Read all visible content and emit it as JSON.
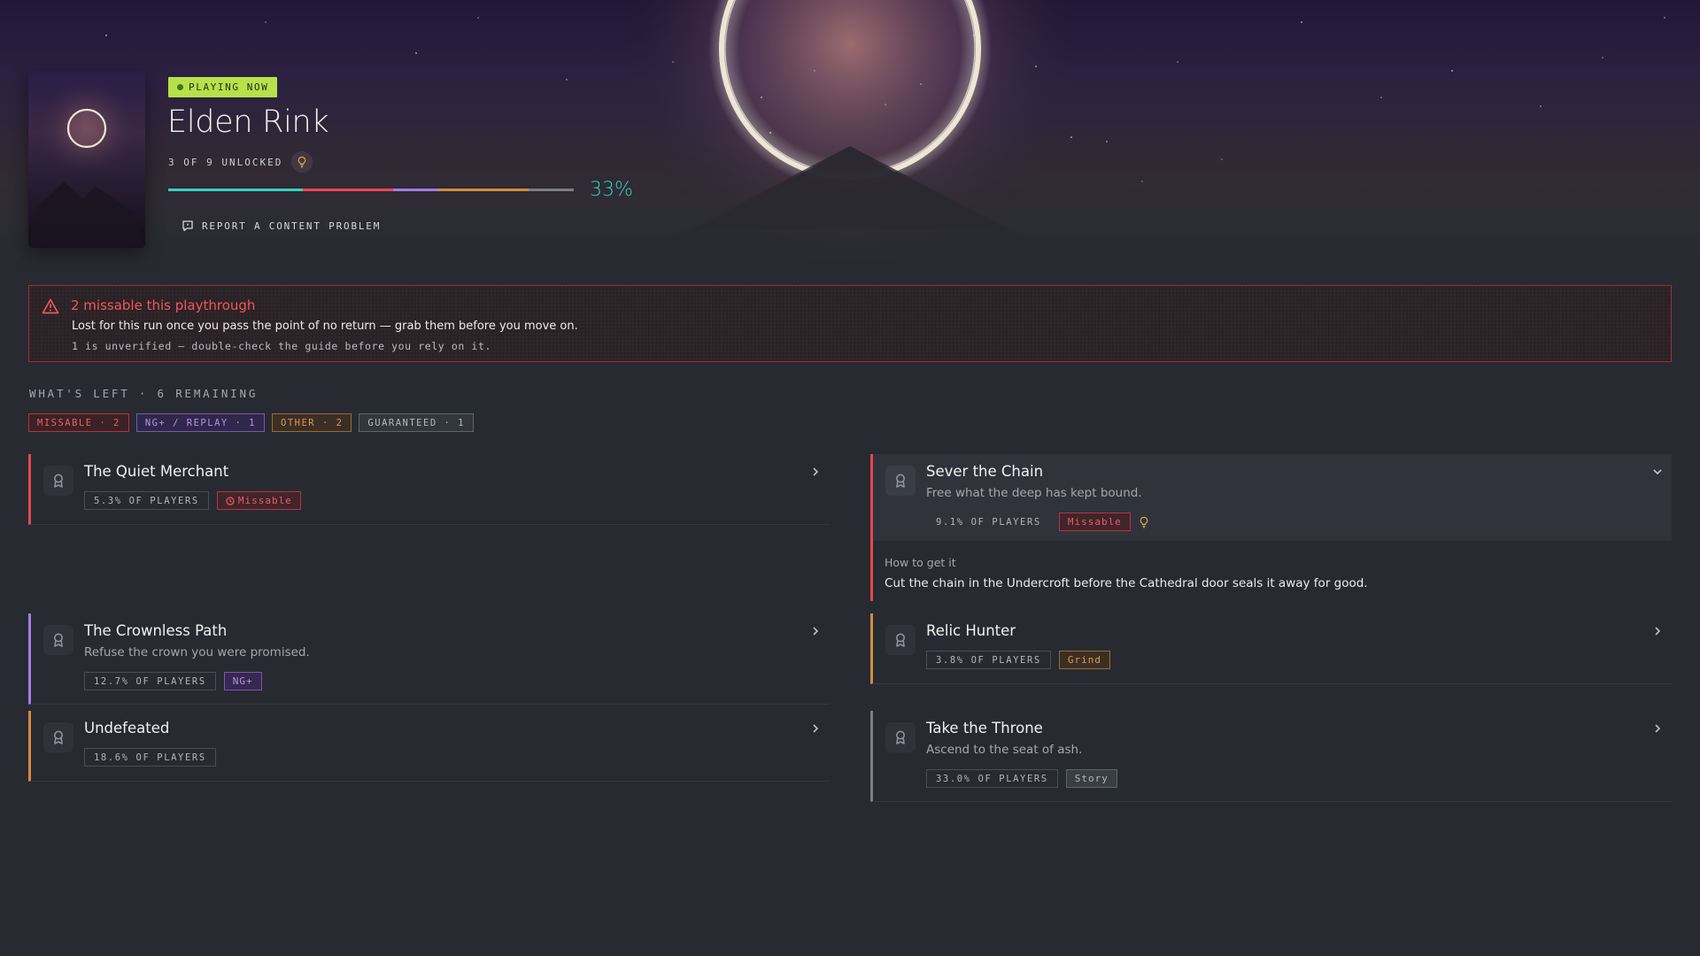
{
  "hero": {
    "status_badge": "PLAYING NOW",
    "game_title": "Elden Rink",
    "unlocked_text": "3 OF 9 UNLOCKED",
    "progress_percent_label": "33%",
    "progress_fraction": 0.33,
    "report_label": "REPORT A CONTENT PROBLEM",
    "accent_color": "#35d1bd",
    "badge_color": "#b8e04a"
  },
  "alert": {
    "title": "2 missable this playthrough",
    "body": "Lost for this run once you pass the point of no return — grab them before you move on.",
    "note": "1 is unverified — double-check the guide before you rely on it.",
    "color": "#f2555f",
    "icon": "warning-triangle-icon"
  },
  "remaining": {
    "label": "WHAT'S LEFT · 6 REMAINING",
    "chips": [
      {
        "label": "MISSABLE · 2",
        "kind": "missable"
      },
      {
        "label": "NG+ / REPLAY · 1",
        "kind": "ng"
      },
      {
        "label": "OTHER · 2",
        "kind": "other"
      },
      {
        "label": "GUARANTEED · 1",
        "kind": "guar"
      }
    ]
  },
  "achievements": {
    "quiet_merchant": {
      "name": "The Quiet Merchant",
      "players": "5.3% OF PLAYERS",
      "tag": "Missable",
      "tag_icon": "clock-icon"
    },
    "sever_chain": {
      "name": "Sever the Chain",
      "desc": "Free what the deep has kept bound.",
      "players": "9.1% OF PLAYERS",
      "tag": "Missable",
      "hint_icon": "lightbulb-icon",
      "howto_label": "How to get it",
      "howto_text": "Cut the chain in the Undercroft before the Cathedral door seals it away for good."
    },
    "crownless_path": {
      "name": "The Crownless Path",
      "desc": "Refuse the crown you were promised.",
      "players": "12.7% OF PLAYERS",
      "tag": "NG+"
    },
    "relic_hunter": {
      "name": "Relic Hunter",
      "players": "3.8% OF PLAYERS",
      "tag": "Grind"
    },
    "undefeated": {
      "name": "Undefeated",
      "players": "18.6% OF PLAYERS"
    },
    "take_throne": {
      "name": "Take the Throne",
      "desc": "Ascend to the seat of ash.",
      "players": "33.0% OF PLAYERS",
      "tag": "Story"
    }
  }
}
